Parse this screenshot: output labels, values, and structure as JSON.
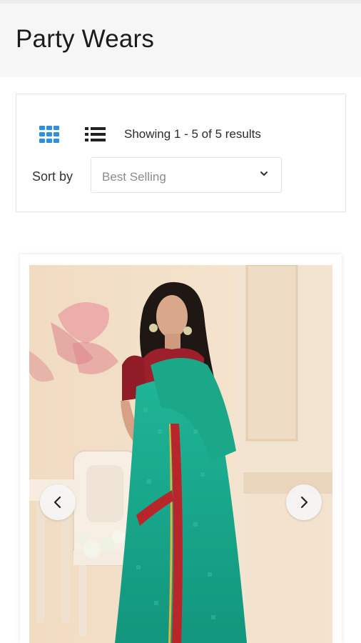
{
  "page": {
    "title": "Party Wears"
  },
  "toolbar": {
    "grid_icon": "grid-view-icon",
    "list_icon": "list-view-icon",
    "results_text": "Showing 1 - 5 of 5 results",
    "sort_label": "Sort by",
    "sort_value": "Best Selling"
  },
  "product": {
    "image": "woman-in-green-saree-photo",
    "prev_icon": "chevron-left-icon",
    "next_icon": "chevron-right-icon"
  },
  "colors": {
    "accent": "#2f8fe0",
    "header_bg": "#f6f6f6",
    "saree_green": "#17a78a",
    "saree_border": "#b8262c"
  }
}
